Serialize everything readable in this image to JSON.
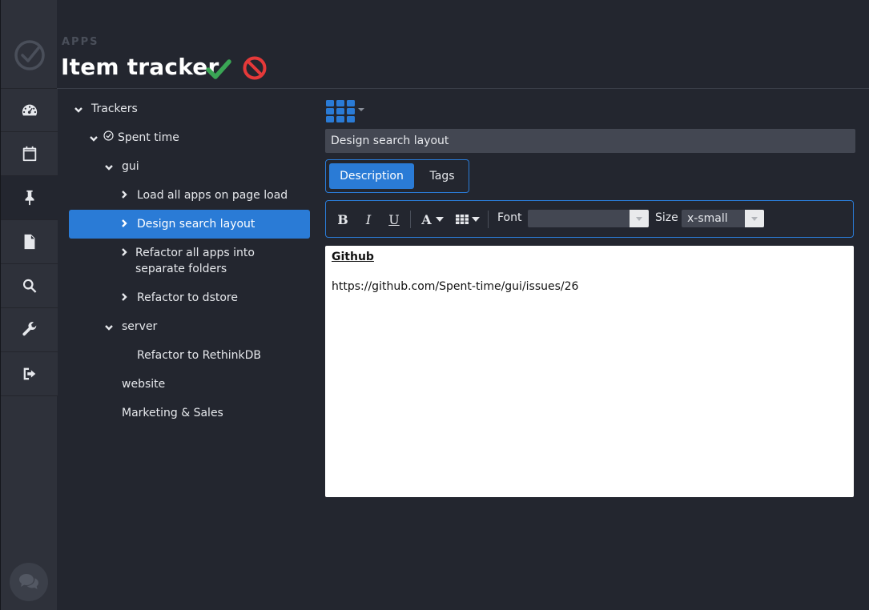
{
  "header": {
    "section_label": "APPS",
    "title": "Item tracker",
    "save_icon": "check-icon",
    "cancel_icon": "ban-icon"
  },
  "colors": {
    "background": "#23262f",
    "rail": "#2e313a",
    "accent": "#2a7bd6",
    "save": "#3aa655",
    "cancel": "#e53939",
    "input_bg": "#434752"
  },
  "rail": {
    "items": [
      {
        "icon": "dashboard-icon"
      },
      {
        "icon": "calendar-icon"
      },
      {
        "icon": "pin-icon",
        "active": true
      },
      {
        "icon": "file-icon"
      },
      {
        "icon": "search-icon"
      },
      {
        "icon": "wrench-icon"
      },
      {
        "icon": "sign-out-icon"
      }
    ],
    "chat_icon": "chat-icon"
  },
  "tree": {
    "root": "Trackers",
    "project": "Spent time",
    "gui": "gui",
    "gui_items": [
      "Load all apps on page load",
      "Design search layout",
      "Refactor all apps into separate folders",
      "Refactor to dstore"
    ],
    "server": "server",
    "server_items": [
      "Refactor to RethinkDB"
    ],
    "website": "website",
    "marketing": "Marketing & Sales",
    "selected": "Design search layout"
  },
  "item": {
    "title": "Design search layout",
    "tabs": [
      "Description",
      "Tags"
    ],
    "active_tab": "Description"
  },
  "toolbar": {
    "bold": "B",
    "italic": "I",
    "underline": "U",
    "font_color": "A",
    "font_label": "Font",
    "font_value": "",
    "size_label": "Size",
    "size_value": "x-small"
  },
  "editor": {
    "heading": "Github",
    "body": "https://github.com/Spent-time/gui/issues/26"
  }
}
